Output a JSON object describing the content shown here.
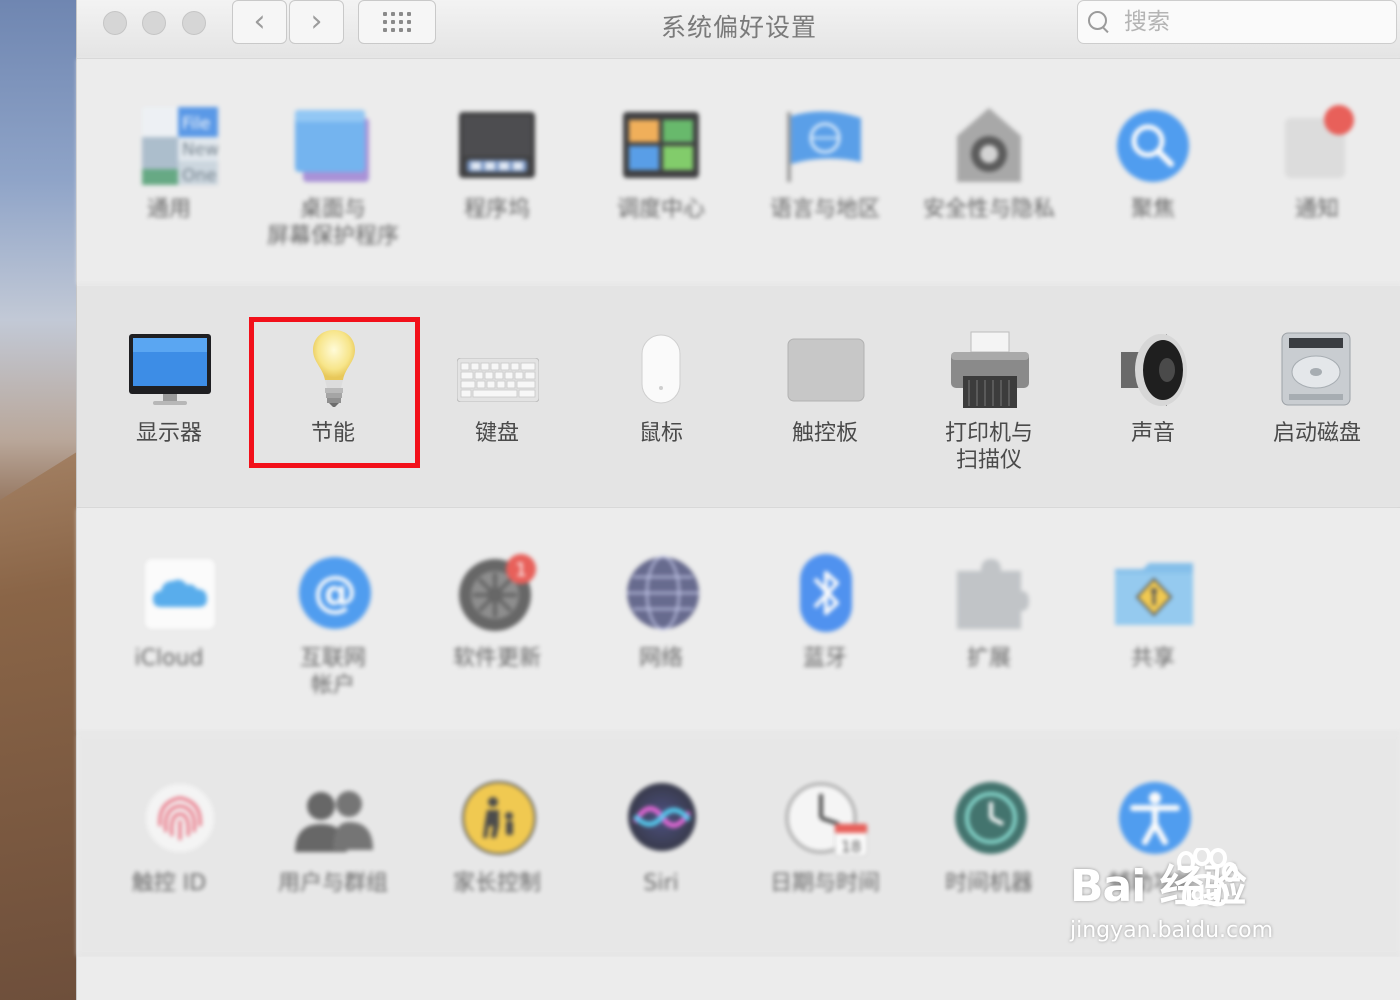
{
  "window": {
    "title": "系统偏好设置",
    "search_placeholder": "搜索"
  },
  "nav": {
    "back_glyph": "‹",
    "forward_glyph": "›"
  },
  "sections": [
    {
      "items": [
        {
          "label": "通用",
          "icon": "general-icon"
        },
        {
          "label": "桌面与\n屏幕保护程序",
          "icon": "desktop-screensaver-icon"
        },
        {
          "label": "程序坞",
          "icon": "dock-icon"
        },
        {
          "label": "调度中心",
          "icon": "mission-control-icon"
        },
        {
          "label": "语言与地区",
          "icon": "language-region-icon"
        },
        {
          "label": "安全性与隐私",
          "icon": "security-privacy-icon"
        },
        {
          "label": "聚焦",
          "icon": "spotlight-icon"
        },
        {
          "label": "通知",
          "icon": "notifications-icon"
        }
      ]
    },
    {
      "items": [
        {
          "label": "显示器",
          "icon": "displays-icon"
        },
        {
          "label": "节能",
          "icon": "energy-saver-icon"
        },
        {
          "label": "键盘",
          "icon": "keyboard-icon"
        },
        {
          "label": "鼠标",
          "icon": "mouse-icon"
        },
        {
          "label": "触控板",
          "icon": "trackpad-icon"
        },
        {
          "label": "打印机与\n扫描仪",
          "icon": "printers-scanners-icon"
        },
        {
          "label": "声音",
          "icon": "sound-icon"
        },
        {
          "label": "启动磁盘",
          "icon": "startup-disk-icon"
        }
      ]
    },
    {
      "items": [
        {
          "label": "iCloud",
          "icon": "icloud-icon"
        },
        {
          "label": "互联网\n帐户",
          "icon": "internet-accounts-icon"
        },
        {
          "label": "软件更新",
          "icon": "software-update-icon",
          "badge": "1"
        },
        {
          "label": "网络",
          "icon": "network-icon"
        },
        {
          "label": "蓝牙",
          "icon": "bluetooth-icon"
        },
        {
          "label": "扩展",
          "icon": "extensions-icon"
        },
        {
          "label": "共享",
          "icon": "sharing-icon"
        }
      ]
    },
    {
      "items": [
        {
          "label": "触控 ID",
          "icon": "touch-id-icon"
        },
        {
          "label": "用户与群组",
          "icon": "users-groups-icon"
        },
        {
          "label": "家长控制",
          "icon": "parental-controls-icon"
        },
        {
          "label": "Siri",
          "icon": "siri-icon"
        },
        {
          "label": "日期与时间",
          "icon": "date-time-icon",
          "calendar_day": "18"
        },
        {
          "label": "时间机器",
          "icon": "time-machine-icon"
        },
        {
          "label": "辅助功能",
          "icon": "accessibility-icon"
        }
      ]
    }
  ],
  "sample_file_labels": [
    "File",
    "New",
    "One"
  ],
  "watermark": {
    "logo_text": "Bai  经验",
    "logo_paw_text": "du",
    "url": "jingyan.baidu.com"
  },
  "colors": {
    "highlight": "#f2101a",
    "accent_blue": "#2f8cf0",
    "badge_red": "#e8423b"
  }
}
